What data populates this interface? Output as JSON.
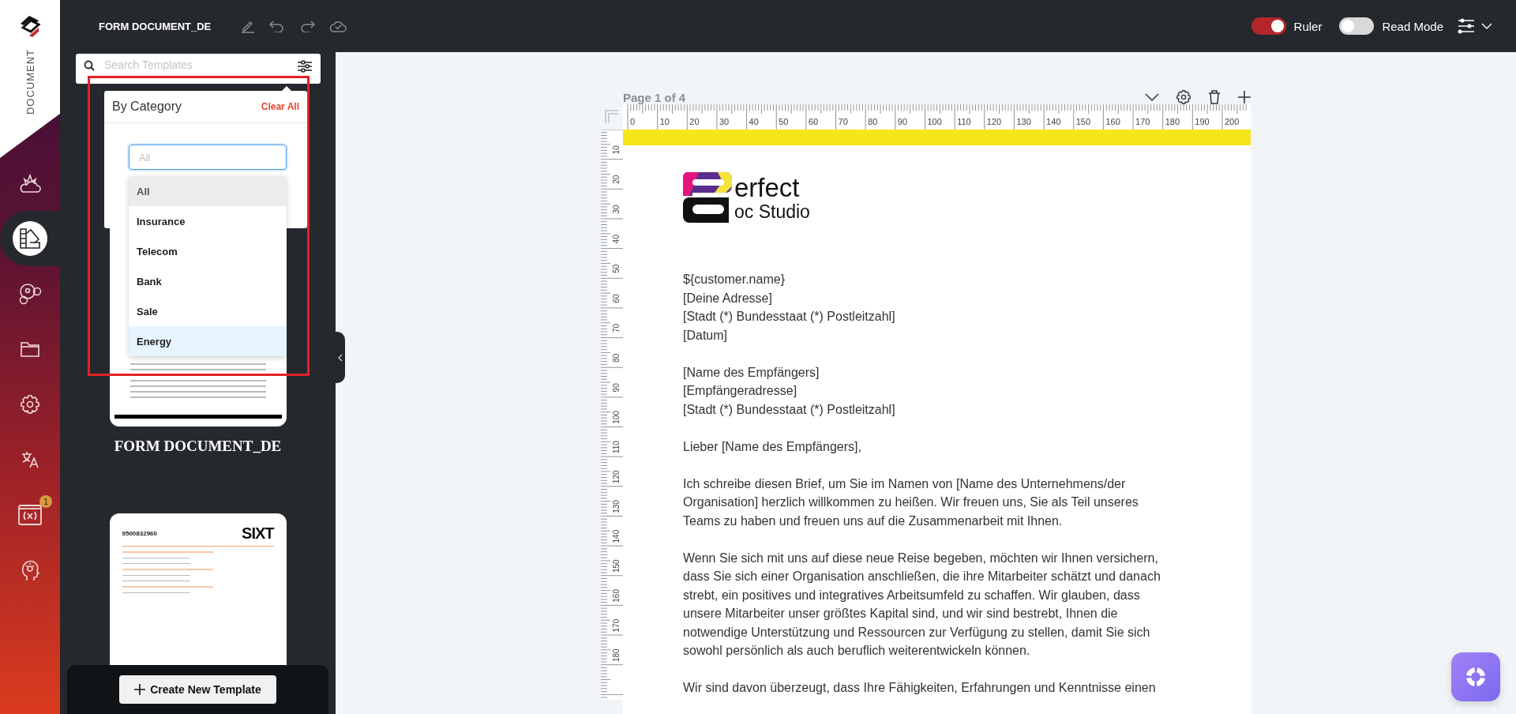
{
  "topbar": {
    "title": "FORM DOCUMENT_DE",
    "toggles": [
      {
        "label": "Ruler",
        "on": true
      },
      {
        "label": "Read Mode",
        "on": false
      }
    ]
  },
  "rail": {
    "brand_label": "DOCUMENT",
    "items": [
      {
        "kind": "cloud",
        "selected": false
      },
      {
        "kind": "swatches",
        "selected": true
      },
      {
        "kind": "molecule",
        "selected": false
      },
      {
        "kind": "folder",
        "selected": false
      },
      {
        "kind": "settings",
        "selected": false
      },
      {
        "kind": "translate",
        "selected": false
      },
      {
        "kind": "variable",
        "selected": false,
        "badge": "1"
      },
      {
        "kind": "idea",
        "selected": false
      }
    ]
  },
  "templates": {
    "search": {
      "placeholder": "Search Templates"
    },
    "filter": {
      "title": "By Category",
      "clear": "Clear All",
      "select": {
        "placeholder": "All",
        "expanded": true
      },
      "options": [
        {
          "label": "All",
          "selected": true,
          "highlighted": false
        },
        {
          "label": "Insurance",
          "selected": false,
          "highlighted": false
        },
        {
          "label": "Telecom",
          "selected": false,
          "highlighted": false
        },
        {
          "label": "Bank",
          "selected": false,
          "highlighted": false
        },
        {
          "label": "Sale",
          "selected": false,
          "highlighted": false
        },
        {
          "label": "Energy",
          "selected": false,
          "highlighted": true
        }
      ]
    },
    "cards": [
      {
        "kind": "letter",
        "name": "FORM DOCUMENT_DE"
      },
      {
        "kind": "invoice",
        "number": "9500832960",
        "logo": "SIXT"
      }
    ],
    "create_button": "Create New Template"
  },
  "page": {
    "label": "Page 1 of 4",
    "ruler": {
      "top_marks": [
        "0",
        "10",
        "20",
        "30",
        "40",
        "50",
        "60",
        "70",
        "80",
        "90",
        "100",
        "110",
        "120",
        "130",
        "140",
        "150",
        "160",
        "170",
        "180",
        "190",
        "200"
      ],
      "side_marks": [
        "10",
        "20",
        "30",
        "40",
        "50",
        "60",
        "70",
        "80",
        "90",
        "100",
        "110",
        "120",
        "130",
        "140",
        "150",
        "160",
        "170",
        "180"
      ]
    },
    "logo": {
      "line_1": "erfect",
      "line_2": "oc Studio"
    },
    "blocks": [
      {
        "kind": "lines",
        "lines": [
          "${customer.name}",
          "[Deine Adresse]",
          "[Stadt (*) Bundesstaat (*) Postleitzahl]",
          "[Datum]"
        ]
      },
      {
        "kind": "lines",
        "lines": [
          "[Name des Empfängers]",
          "[Empfängeradresse]",
          "[Stadt (*) Bundesstaat (*) Postleitzahl]"
        ]
      },
      {
        "kind": "paragraph",
        "text": "Lieber [Name des Empfängers],"
      },
      {
        "kind": "paragraph",
        "text": "Ich schreibe diesen Brief, um Sie im Namen von [Name des Unternehmens/der Organisation] herzlich willkommen zu heißen. Wir freuen uns, Sie als Teil unseres Teams zu haben und freuen uns auf die Zusammenarbeit mit Ihnen."
      },
      {
        "kind": "paragraph",
        "text": "Wenn Sie sich mit uns auf diese neue Reise begeben, möchten wir Ihnen versichern, dass Sie sich einer Organisation anschließen, die ihre Mitarbeiter schätzt und danach strebt, ein positives und integratives Arbeitsumfeld zu schaffen. Wir glauben, dass unsere Mitarbeiter unser größtes Kapital sind, und wir sind bestrebt, Ihnen die notwendige Unterstützung und Ressourcen zur Verfügung zu stellen, damit Sie sich sowohl persönlich als auch beruflich weiterentwickeln können."
      },
      {
        "kind": "paragraph",
        "text": "Wir sind davon überzeugt, dass Ihre Fähigkeiten, Erfahrungen und Kenntnisse einen"
      }
    ]
  }
}
